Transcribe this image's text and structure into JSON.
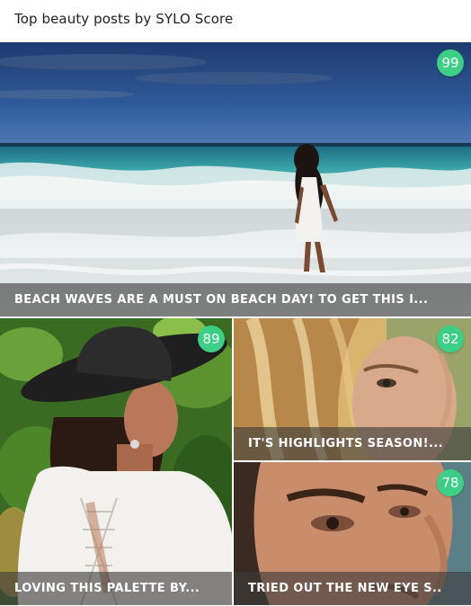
{
  "header": {
    "title": "Top beauty posts by SYLO Score"
  },
  "posts": [
    {
      "score": "99",
      "caption": "BEACH WAVES ARE A MUST ON BEACH DAY! TO GET THIS I..."
    },
    {
      "score": "89",
      "caption": "LOVING THIS PALETTE BY..."
    },
    {
      "score": "82",
      "caption": "IT'S HIGHLIGHTS SEASON!..."
    },
    {
      "score": "78",
      "caption": "TRIED OUT THE NEW EYE S.."
    }
  ],
  "colors": {
    "score_badge": "#3ccf86",
    "caption_overlay": "#3c3c3c"
  }
}
